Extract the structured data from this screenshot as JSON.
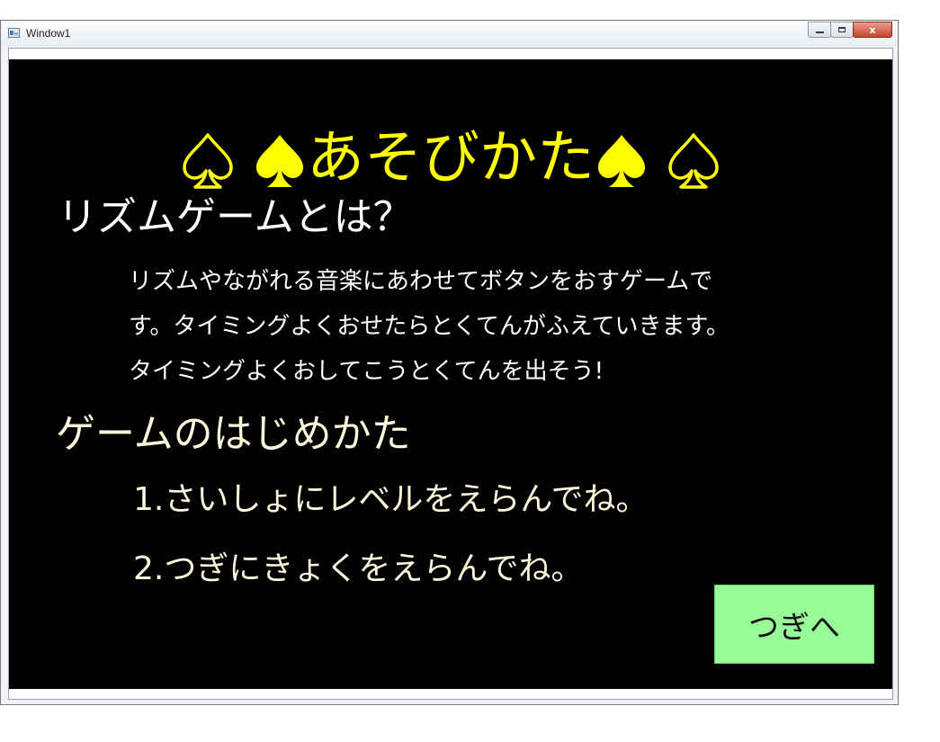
{
  "window": {
    "title": "Window1",
    "minimize_label": "",
    "maximize_label": "",
    "close_label": "x"
  },
  "page": {
    "heading": "あそびかた",
    "section1_title": "リズムゲームとは？",
    "description_lines": [
      "リズムやながれる音楽にあわせてボタンをおすゲームで",
      "す。タイミングよくおせたらとくてんがふえていきます。",
      "タイミングよくおしてこうとくてんを出そう!"
    ],
    "section2_title": "ゲームのはじめかた",
    "steps": [
      "1.さいしょにレベルをえらんでね。",
      "2.つぎにきょくをえらんでね。"
    ],
    "next_button": "つぎへ"
  },
  "colors": {
    "background": "#000000",
    "heading": "#ffff00",
    "text": "#ffffff",
    "steps": "#fff8dc",
    "button": "#98fb98"
  }
}
